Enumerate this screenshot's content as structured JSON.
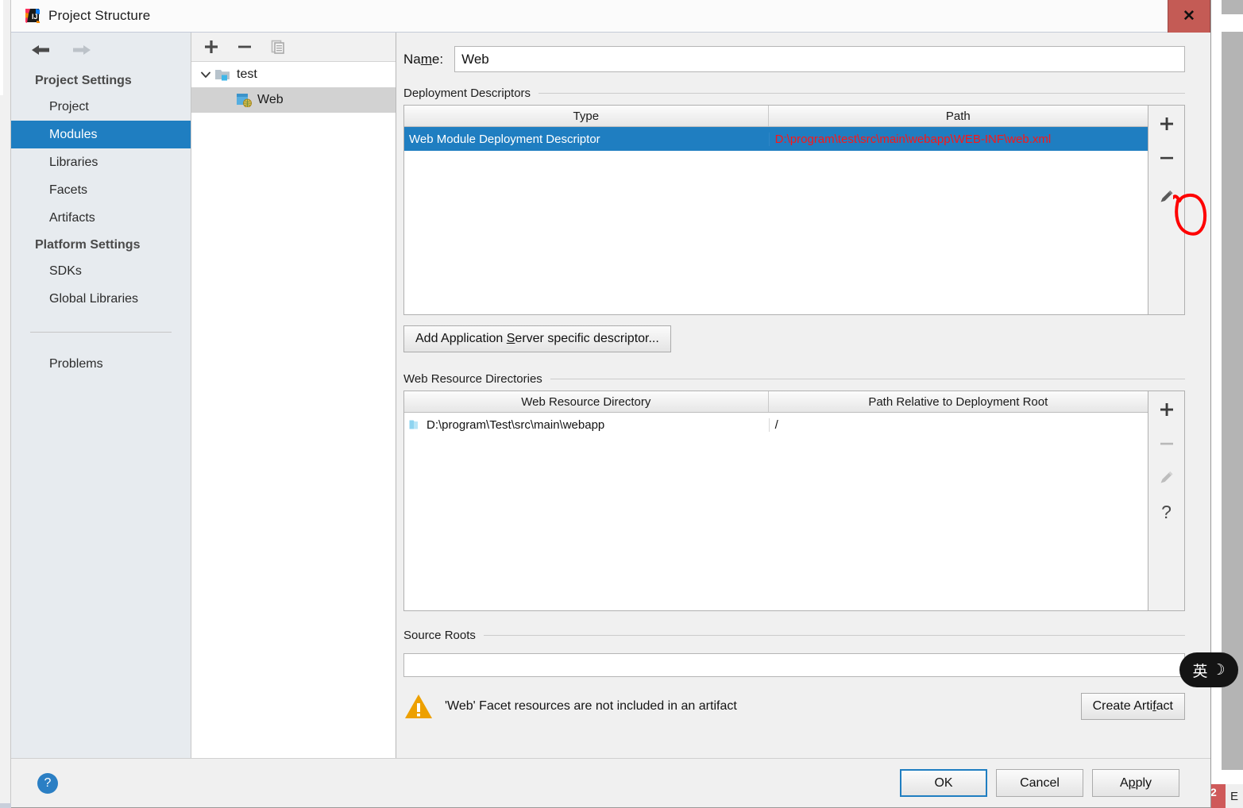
{
  "window": {
    "title": "Project Structure",
    "app_icon": "intellij-idea-icon",
    "close_label": "✕"
  },
  "sidebar": {
    "nav": {
      "back_icon": "arrow-left-icon",
      "forward_icon": "arrow-right-icon"
    },
    "groups": [
      {
        "label": "Project Settings",
        "items": [
          {
            "label": "Project",
            "selected": false
          },
          {
            "label": "Modules",
            "selected": true
          },
          {
            "label": "Libraries",
            "selected": false
          },
          {
            "label": "Facets",
            "selected": false
          },
          {
            "label": "Artifacts",
            "selected": false
          }
        ]
      },
      {
        "label": "Platform Settings",
        "items": [
          {
            "label": "SDKs",
            "selected": false
          },
          {
            "label": "Global Libraries",
            "selected": false
          }
        ]
      }
    ],
    "problems": {
      "label": "Problems"
    }
  },
  "module_tree": {
    "toolbar": [
      {
        "name": "add-module-button",
        "glyph": "+"
      },
      {
        "name": "remove-module-button",
        "glyph": "−"
      },
      {
        "name": "copy-module-button",
        "glyph": "copy-icon"
      }
    ],
    "nodes": [
      {
        "label": "test",
        "icon": "module-folder-icon",
        "expanded": true,
        "selected": false
      },
      {
        "label": "Web",
        "icon": "web-facet-icon",
        "selected": true
      }
    ]
  },
  "main": {
    "name_field": {
      "label_prefix": "Na",
      "label_mnemonic": "m",
      "label_suffix": "e:",
      "value": "Web",
      "placeholder": ""
    },
    "deployment_descriptors": {
      "title": "Deployment Descriptors",
      "columns": [
        "Type",
        "Path"
      ],
      "rows": [
        {
          "type": "Web Module Deployment Descriptor",
          "path": "D:\\program\\test\\src\\main\\webapp\\WEB-INF\\web.xml",
          "selected": true,
          "path_color": "#ff1515"
        }
      ],
      "tools": [
        {
          "name": "add-descriptor-button",
          "glyph": "+",
          "enabled": true
        },
        {
          "name": "remove-descriptor-button",
          "glyph": "−",
          "enabled": true
        },
        {
          "name": "edit-descriptor-button",
          "glyph": "pencil-icon",
          "enabled": true,
          "annotated": true
        }
      ],
      "add_button": {
        "prefix": "Add Application ",
        "mnemonic": "S",
        "suffix": "erver specific descriptor..."
      }
    },
    "web_resource_directories": {
      "title": "Web Resource Directories",
      "columns": [
        "Web Resource Directory",
        "Path Relative to Deployment Root"
      ],
      "rows": [
        {
          "directory": "D:\\program\\Test\\src\\main\\webapp",
          "relative_path": "/",
          "selected": false
        }
      ],
      "tools": [
        {
          "name": "add-web-resource-button",
          "glyph": "+",
          "enabled": true
        },
        {
          "name": "remove-web-resource-button",
          "glyph": "−",
          "enabled": false
        },
        {
          "name": "edit-web-resource-button",
          "glyph": "pencil-icon",
          "enabled": false
        },
        {
          "name": "web-resource-help-button",
          "glyph": "?",
          "enabled": true
        }
      ]
    },
    "source_roots": {
      "title": "Source Roots",
      "value": ""
    },
    "warning": {
      "icon": "warning-triangle-icon",
      "text": "'Web' Facet resources are not included in an artifact",
      "action": {
        "prefix": "Create Arti",
        "mnemonic": "f",
        "suffix": "act"
      }
    }
  },
  "footer": {
    "help_icon": "?",
    "ok_label": "OK",
    "cancel_label": "Cancel",
    "apply_prefix": "A",
    "apply_mnemonic": "p",
    "apply_suffix": "ply"
  },
  "overlay": {
    "ime_badge": {
      "mode": "英",
      "moon": "☽"
    },
    "annotation": {
      "shape": "red-ellipse",
      "color": "#ff0000",
      "target": "edit-descriptor-button"
    }
  },
  "background": {
    "taskbar_badge": "2",
    "taskbar_letter": "E"
  },
  "colors": {
    "accent": "#1f7ec1",
    "selection": "#1f7ec1",
    "error_text": "#ff1515",
    "warning": "#eda000",
    "close_button": "#c45b55",
    "dialog_bg": "#f0f0f0",
    "sidebar_bg": "#e7ebef"
  }
}
